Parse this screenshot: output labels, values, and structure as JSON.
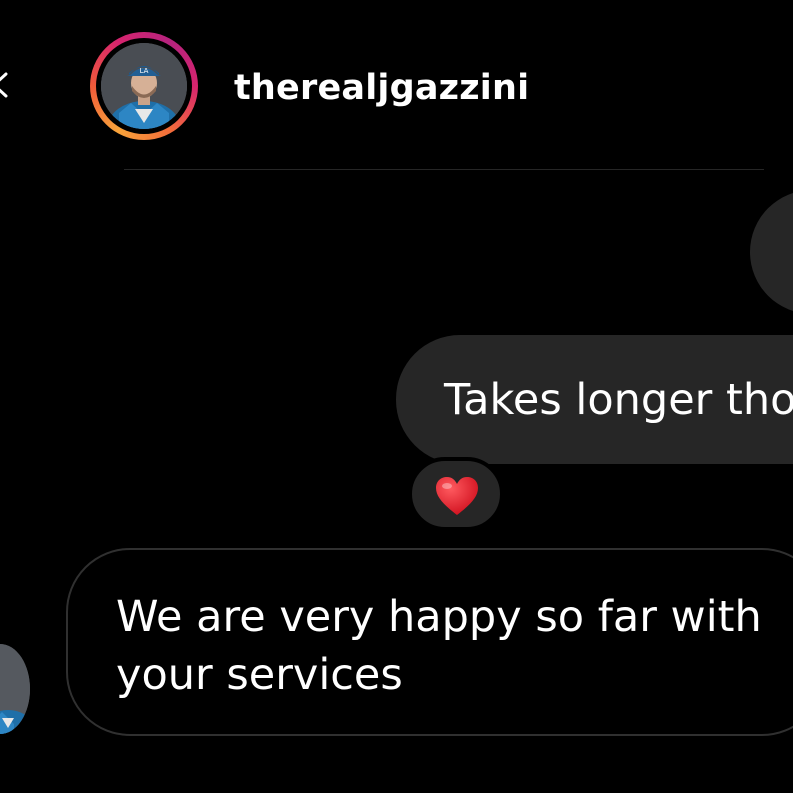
{
  "header": {
    "back_icon": "back-arrow-icon",
    "username": "therealjgazzini",
    "avatar": "profile-photo"
  },
  "messages": [
    {
      "direction": "sent",
      "text": "Takes longer tho",
      "reaction": "red-heart"
    },
    {
      "direction": "received",
      "text": "We are very happy so far with your services"
    }
  ],
  "colors": {
    "background": "#000000",
    "bubble": "#262626",
    "received_border": "#303030",
    "text": "#ffffff",
    "heart": "#e0202f",
    "story_ring": [
      "#f8a33a",
      "#d6246e"
    ]
  }
}
